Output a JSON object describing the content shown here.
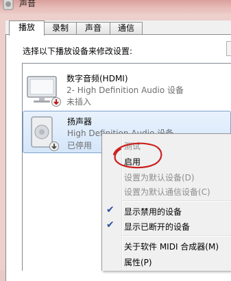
{
  "window": {
    "title": "声音",
    "icon": "speaker-icon"
  },
  "tabs": [
    {
      "label": "播放",
      "active": true
    },
    {
      "label": "录制",
      "active": false
    },
    {
      "label": "声音",
      "active": false
    },
    {
      "label": "通信",
      "active": false
    }
  ],
  "instruction": "选择以下播放设备来修改设置:",
  "devices": [
    {
      "name": "数字音频(HDMI)",
      "description": "2- High Definition Audio 设备",
      "status": "未插入",
      "icon": "monitor-icon",
      "badge": "red-down-arrow"
    },
    {
      "name": "扬声器",
      "description": "High Definition Audio 设备",
      "status": "已停用",
      "icon": "speaker-device-icon",
      "badge": "gray-down-arrow"
    }
  ],
  "context_menu": {
    "items": [
      {
        "label": "测试",
        "enabled": false
      },
      {
        "label": "启用",
        "enabled": true
      },
      {
        "label": "设置为默认设备(D)",
        "enabled": false
      },
      {
        "label": "设置为默认通信设备(C)",
        "enabled": false
      },
      {
        "label": "显示禁用的设备",
        "enabled": true,
        "checked": true
      },
      {
        "label": "显示已断开的设备",
        "enabled": true,
        "checked": true
      },
      {
        "label": "关于软件 MIDI 合成器(M)",
        "enabled": true
      },
      {
        "label": "属性(P)",
        "enabled": true
      }
    ]
  },
  "colors": {
    "annotation": "#cc1f1f",
    "selection_border": "#7da2ce",
    "check": "#2a4d9e"
  }
}
